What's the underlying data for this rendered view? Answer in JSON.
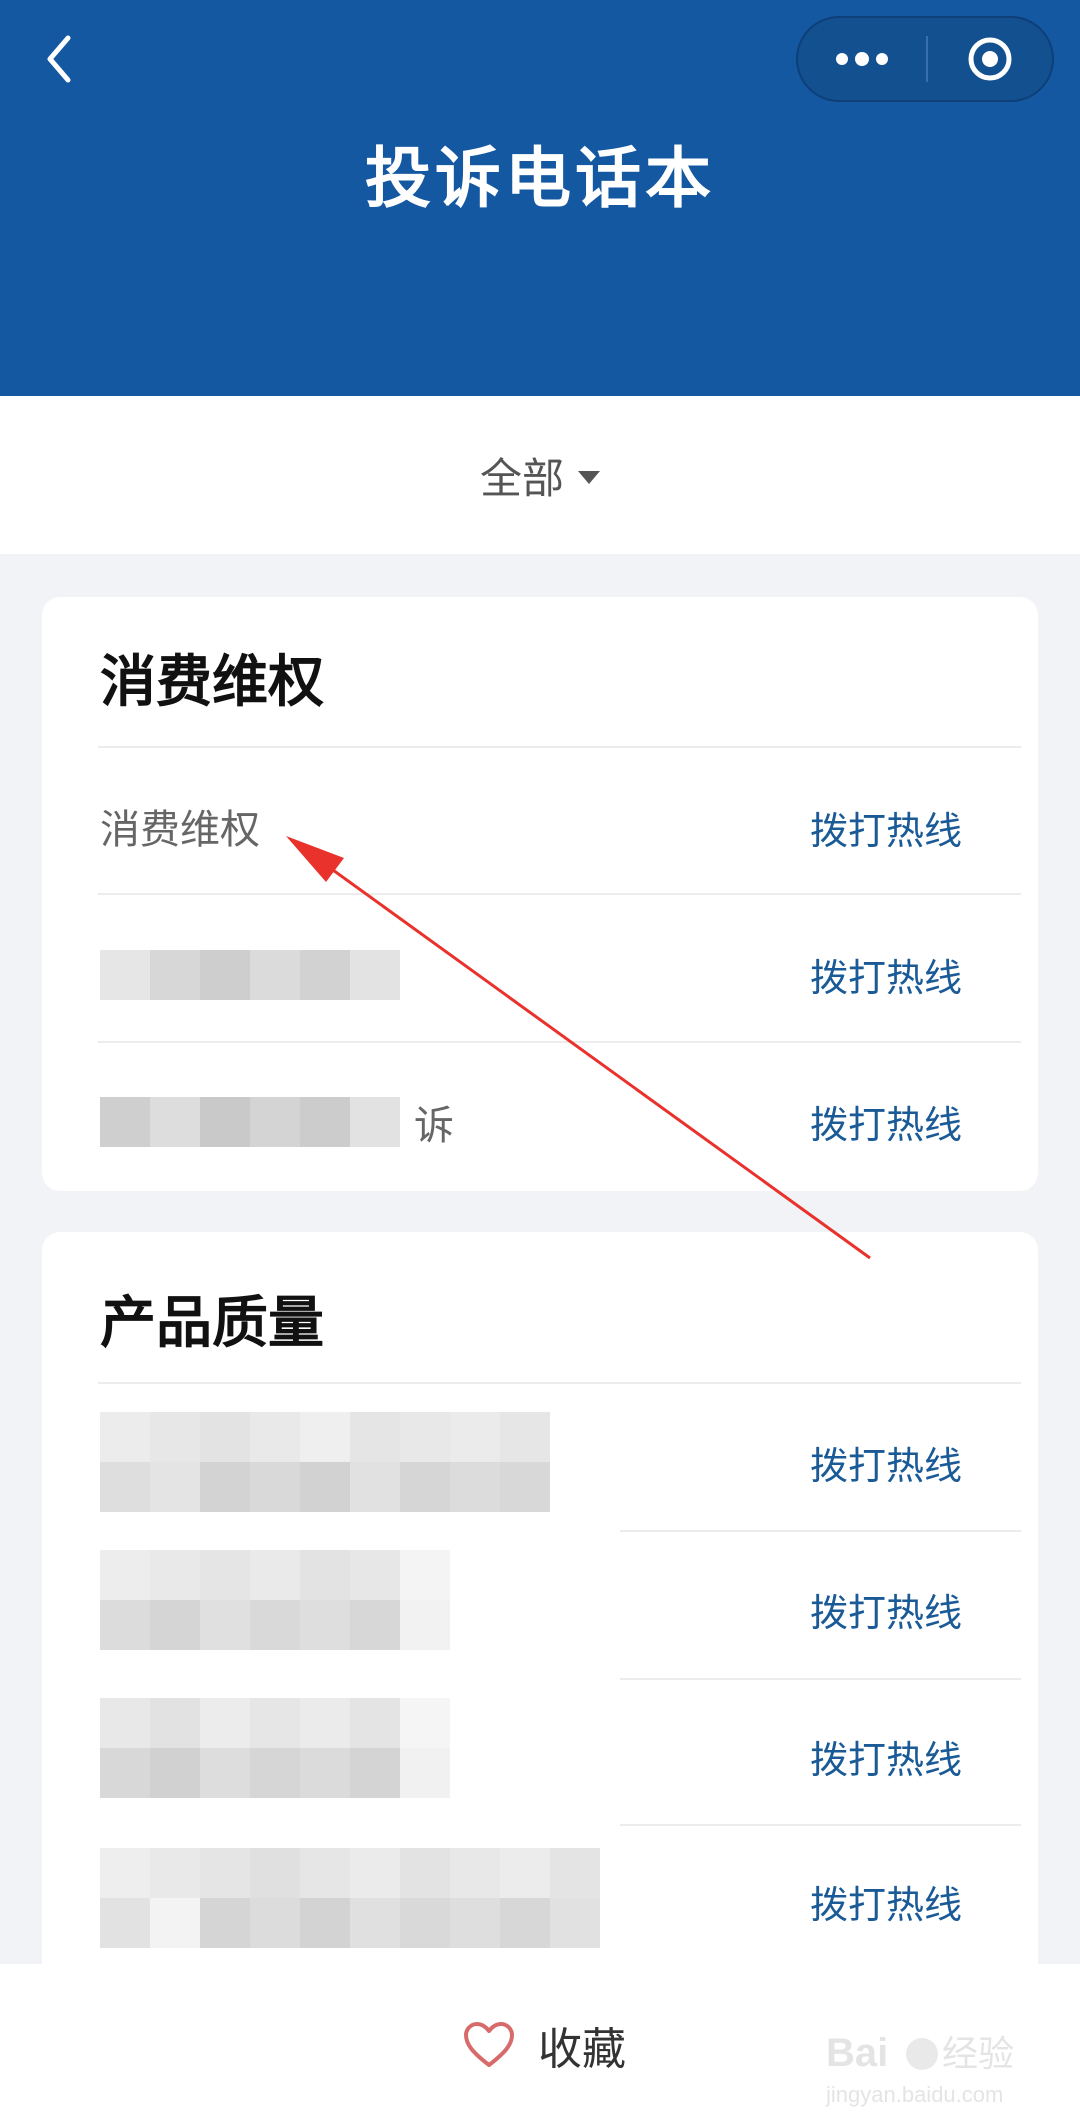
{
  "header": {
    "title": "投诉电话本",
    "color": "#1558a2"
  },
  "filter": {
    "selected": "全部"
  },
  "sections": [
    {
      "title": "消费维权",
      "rows": [
        {
          "name": "消费维权",
          "action": "拨打热线"
        },
        {
          "name": "",
          "action": "拨打热线"
        },
        {
          "name": "诉",
          "action": "拨打热线"
        }
      ]
    },
    {
      "title": "产品质量",
      "rows": [
        {
          "name": "",
          "action": "拨打热线"
        },
        {
          "name": "",
          "action": "拨打热线"
        },
        {
          "name": "",
          "action": "拨打热线"
        },
        {
          "name": "",
          "action": "拨打热线"
        }
      ]
    }
  ],
  "bottom_bar": {
    "favorite_label": "收藏"
  },
  "watermark": {
    "brand": "Baidu经验",
    "url": "jingyan.baidu.com"
  },
  "icons": [
    "chevron-left-icon",
    "more-dots-icon",
    "target-circle-icon",
    "caret-down-icon",
    "heart-icon"
  ],
  "colors": {
    "accent": "#1a5a96",
    "annotation_arrow": "#e8322b"
  }
}
